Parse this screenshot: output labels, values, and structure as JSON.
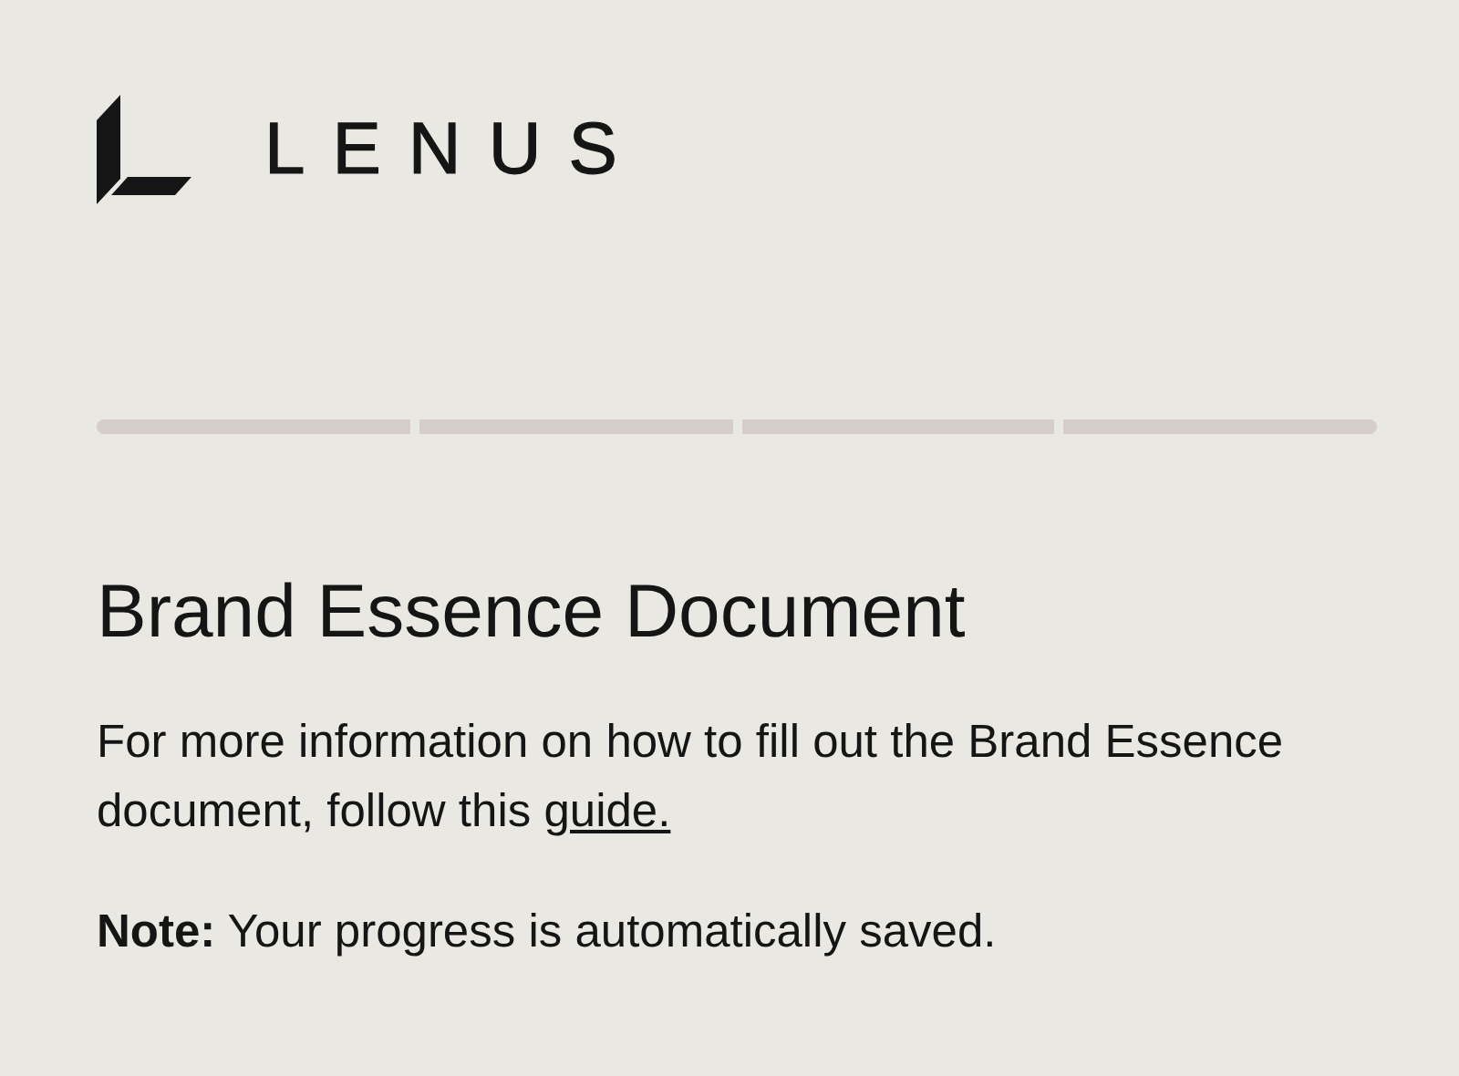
{
  "logo": {
    "text": "LENUS"
  },
  "progress_steps": [
    {
      "completed": false
    },
    {
      "completed": false
    },
    {
      "completed": false
    },
    {
      "completed": false
    }
  ],
  "title": "Brand Essence Document",
  "info": {
    "text": "For more information on how to fill out the Brand Essence document, follow this ",
    "link": "guide."
  },
  "note": "**Note:** Your progress is automatically saved."
}
